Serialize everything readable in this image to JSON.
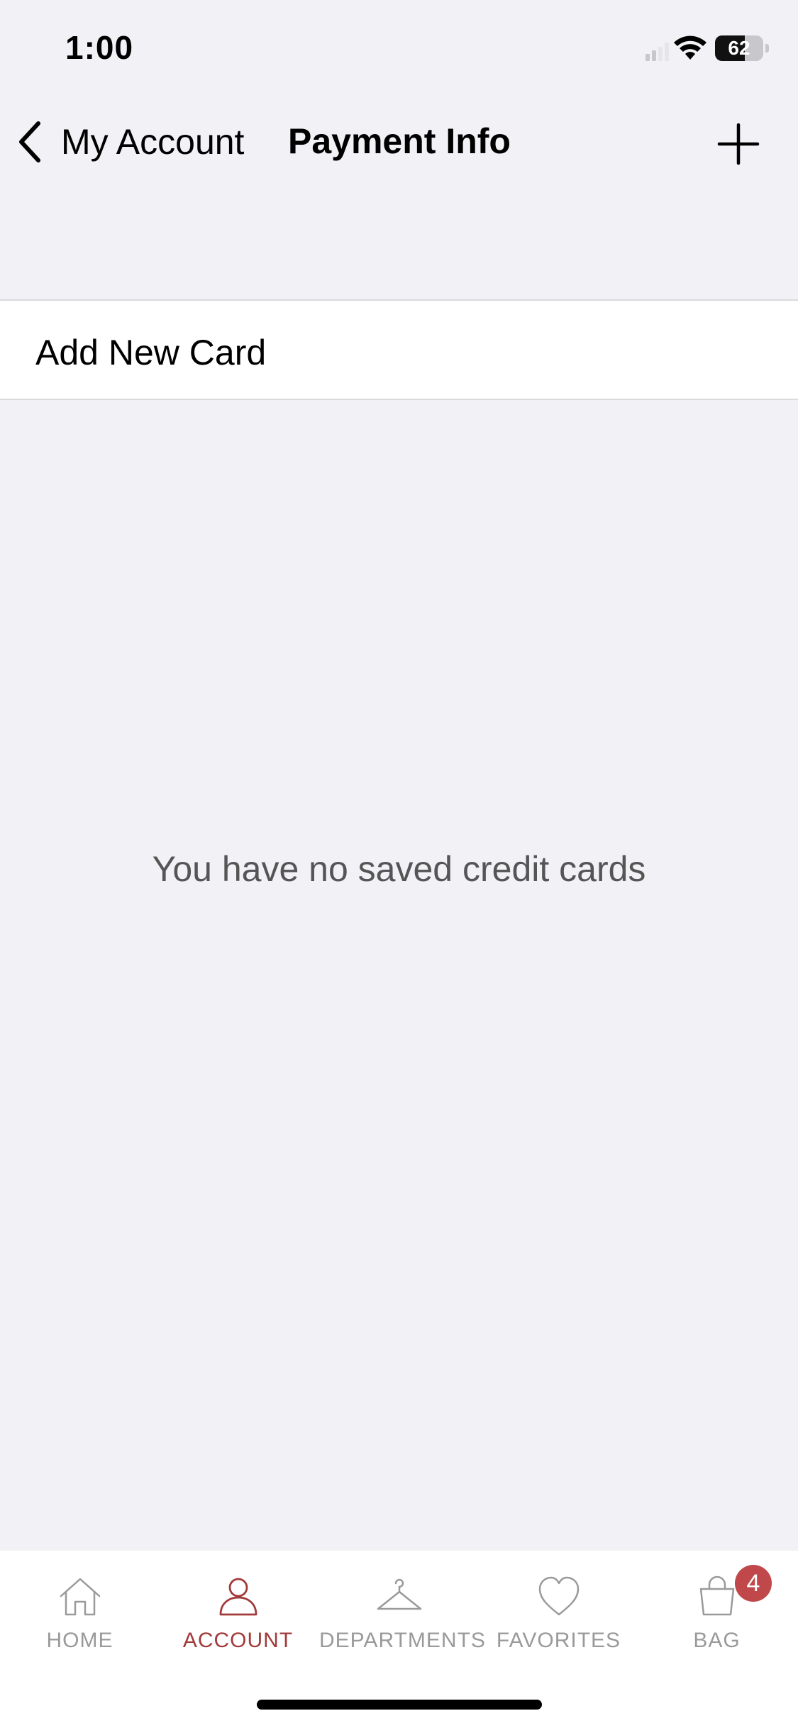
{
  "status_bar": {
    "time": "1:00",
    "battery_level": "62",
    "battery_fraction": 0.62
  },
  "nav": {
    "back_label": "My Account",
    "title": "Payment Info",
    "back_icon": "chevron-left-icon",
    "add_icon": "plus-icon"
  },
  "add_card": {
    "label": "Add New Card"
  },
  "empty_state": {
    "message": "You have no saved credit cards"
  },
  "tab_bar": {
    "active_color": "#A23A3A",
    "inactive_color": "#9A9A9A",
    "tabs": [
      {
        "label": "HOME",
        "icon": "home-icon"
      },
      {
        "label": "ACCOUNT",
        "icon": "person-icon",
        "active": true
      },
      {
        "label": "DEPARTMENTS",
        "icon": "hanger-icon"
      },
      {
        "label": "FAVORITES",
        "icon": "heart-icon"
      },
      {
        "label": "BAG",
        "icon": "bag-icon",
        "badge": "4"
      }
    ]
  },
  "colors": {
    "background": "#F1F1F6",
    "accent": "#A23A3A",
    "badge": "#C0484A"
  }
}
